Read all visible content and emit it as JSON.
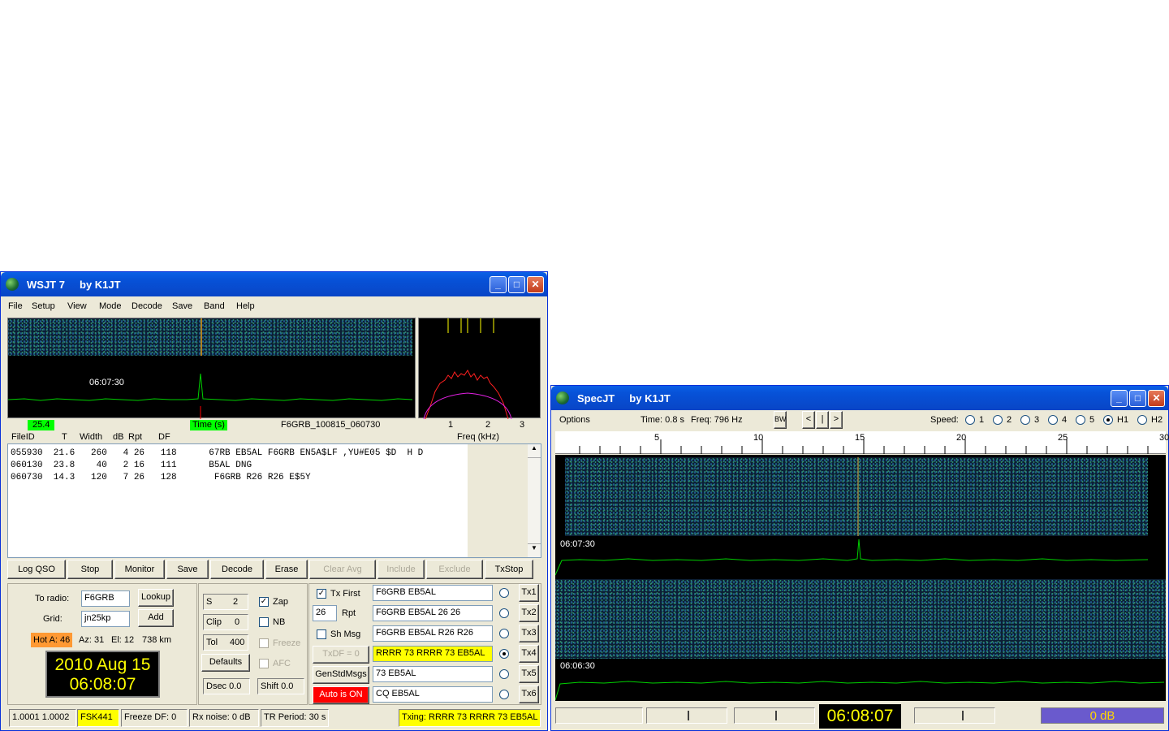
{
  "wsjt": {
    "title": "WSJT 7     by K1JT",
    "menu": [
      "File",
      "Setup",
      "View",
      "Mode",
      "Decode",
      "Save",
      "Band",
      "Help"
    ],
    "plot": {
      "time_label": "06:07:30",
      "green_value": "25.4",
      "time_axis": "Time (s)",
      "file_label": "F6GRB_100815_060730",
      "freq_ticks": [
        "1",
        "2",
        "3"
      ],
      "freq_axis": "Freq (kHz)"
    },
    "headers": [
      "FileID",
      "T",
      "Width",
      "dB",
      "Rpt",
      "DF"
    ],
    "decodes": [
      "055930  21.6   260   4 26   118      67RB EB5AL F6GRB EN5A$LF ,YU#E05 $D  H D",
      "060130  23.8    40   2 16   111      B5AL DNG",
      "060730  14.3   120   7 26   128       F6GRB R26 R26 E$5Y"
    ],
    "buttons": [
      "Log QSO",
      "Stop",
      "Monitor",
      "Save",
      "Decode",
      "Erase",
      "Clear Avg",
      "Include",
      "Exclude",
      "TxStop"
    ],
    "to_radio_label": "To radio:",
    "to_radio": "F6GRB",
    "grid_label": "Grid:",
    "grid": "jn25kp",
    "lookup": "Lookup",
    "add": "Add",
    "hot": "Hot A: 46",
    "az": "Az: 31",
    "el": "El: 12",
    "dist": "738 km",
    "date": "2010 Aug 15",
    "clock": "06:08:07",
    "s_label": "S",
    "s_val": "2",
    "clip_label": "Clip",
    "clip_val": "0",
    "tol_label": "Tol",
    "tol_val": "400",
    "defaults": "Defaults",
    "dsec": "Dsec  0.0",
    "shift": "Shift 0.0",
    "zap": "Zap",
    "nb": "NB",
    "freeze": "Freeze",
    "afc": "AFC",
    "txfirst": "Tx First",
    "rpt_val": "26",
    "rpt_label": "Rpt",
    "shmsg": "Sh Msg",
    "txdf": "TxDF = 0",
    "genstd": "GenStdMsgs",
    "auto": "Auto is ON",
    "tx_msgs": [
      "F6GRB EB5AL",
      "F6GRB EB5AL 26 26",
      "F6GRB EB5AL R26 R26",
      "RRRR 73 RRRR 73 EB5AL",
      "73 EB5AL",
      "CQ EB5AL"
    ],
    "tx_labels": [
      "Tx1",
      "Tx2",
      "Tx3",
      "Tx4",
      "Tx5",
      "Tx6"
    ],
    "status": {
      "dfs": "1.0001 1.0002",
      "mode": "FSK441",
      "freeze_df": "Freeze DF:   0",
      "rxnoise": "Rx noise:   0 dB",
      "trperiod": "TR Period: 30 s",
      "txing": "Txing:  RRRR 73 RRRR 73 EB5AL"
    },
    "colors": {
      "accent_green": "#00ff00",
      "highlight_yellow": "#ffff00",
      "auto_red": "#ff0000",
      "hot_orange": "#ff9933"
    }
  },
  "spec": {
    "title": "SpecJT     by K1JT",
    "options": "Options",
    "time": "Time:  0.8 s",
    "freq": "Freq: 796 Hz",
    "bw": "BW",
    "nav": [
      "<",
      "|",
      ">"
    ],
    "speed_label": "Speed:",
    "speeds": [
      "1",
      "2",
      "3",
      "4",
      "5",
      "H1",
      "H2"
    ],
    "speed_selected": "H1",
    "ticks": [
      "5",
      "10",
      "15",
      "20",
      "25",
      "30"
    ],
    "t1": "06:07:30",
    "t2": "06:06:30",
    "clock": "06:08:07",
    "db": "0 dB"
  }
}
